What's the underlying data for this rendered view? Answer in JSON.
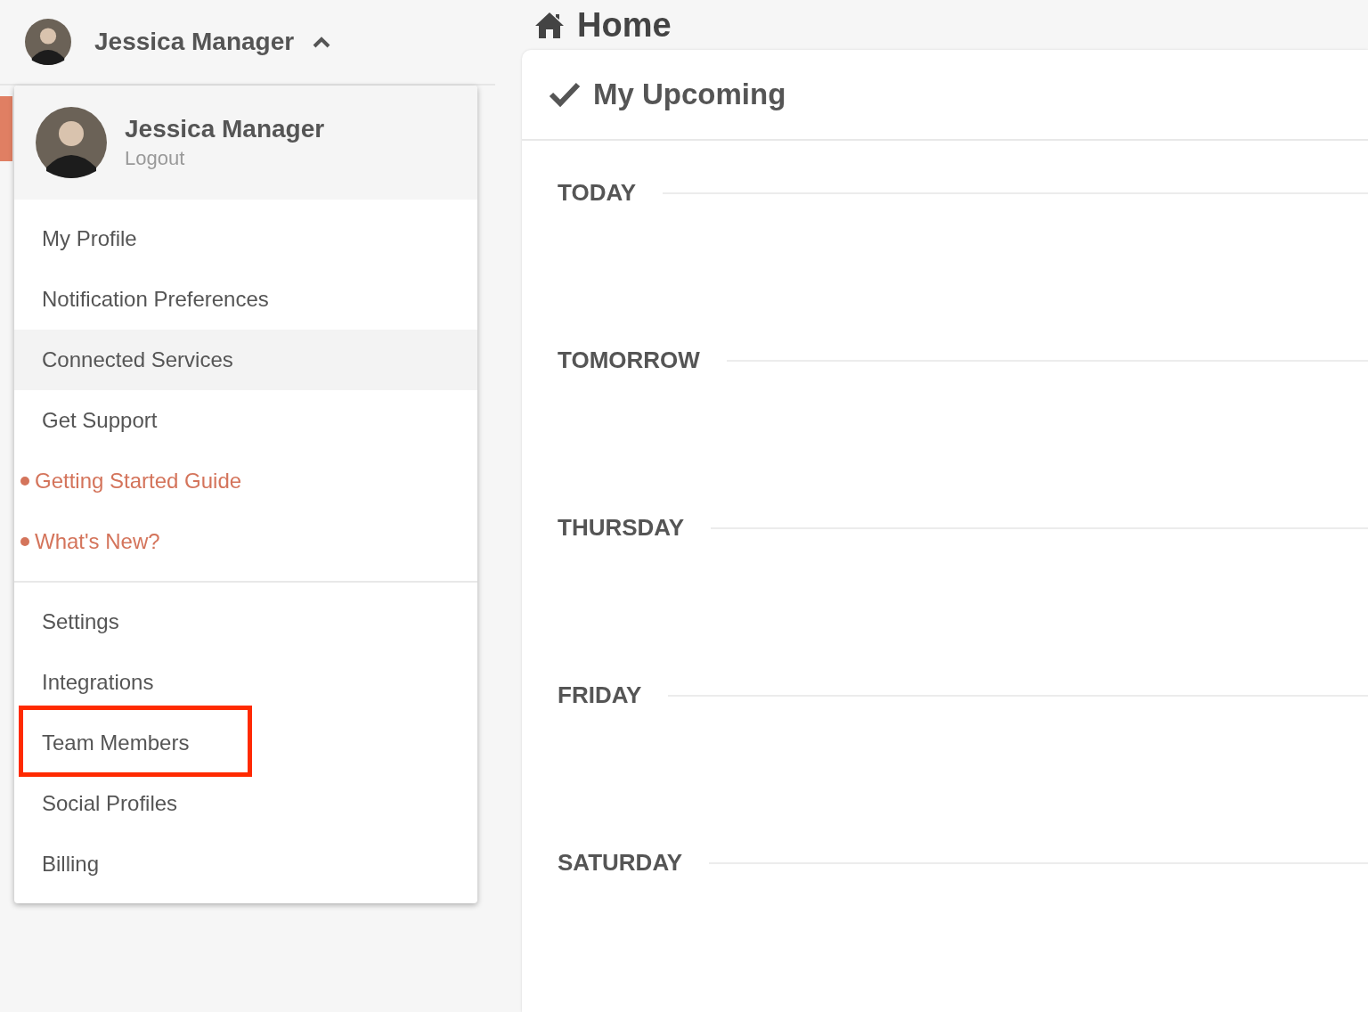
{
  "user_menu": {
    "name": "Jessica Manager",
    "expanded": true
  },
  "page": {
    "title": "Home"
  },
  "dropdown": {
    "name": "Jessica Manager",
    "logout": "Logout",
    "groups": [
      {
        "items": [
          {
            "label": "My Profile",
            "kind": "normal",
            "hovered": false,
            "highlighted": false
          },
          {
            "label": "Notification Preferences",
            "kind": "normal",
            "hovered": false,
            "highlighted": false
          },
          {
            "label": "Connected Services",
            "kind": "normal",
            "hovered": true,
            "highlighted": false
          },
          {
            "label": "Get Support",
            "kind": "normal",
            "hovered": false,
            "highlighted": false
          },
          {
            "label": "Getting Started Guide",
            "kind": "promo",
            "hovered": false,
            "highlighted": false
          },
          {
            "label": "What's New?",
            "kind": "promo",
            "hovered": false,
            "highlighted": false
          }
        ]
      },
      {
        "items": [
          {
            "label": "Settings",
            "kind": "normal",
            "hovered": false,
            "highlighted": false
          },
          {
            "label": "Integrations",
            "kind": "normal",
            "hovered": false,
            "highlighted": false
          },
          {
            "label": "Team Members",
            "kind": "normal",
            "hovered": false,
            "highlighted": true
          },
          {
            "label": "Social Profiles",
            "kind": "normal",
            "hovered": false,
            "highlighted": false
          },
          {
            "label": "Billing",
            "kind": "normal",
            "hovered": false,
            "highlighted": false
          }
        ]
      }
    ]
  },
  "upcoming": {
    "title": "My Upcoming",
    "days": [
      "TODAY",
      "TOMORROW",
      "THURSDAY",
      "FRIDAY",
      "SATURDAY"
    ]
  }
}
